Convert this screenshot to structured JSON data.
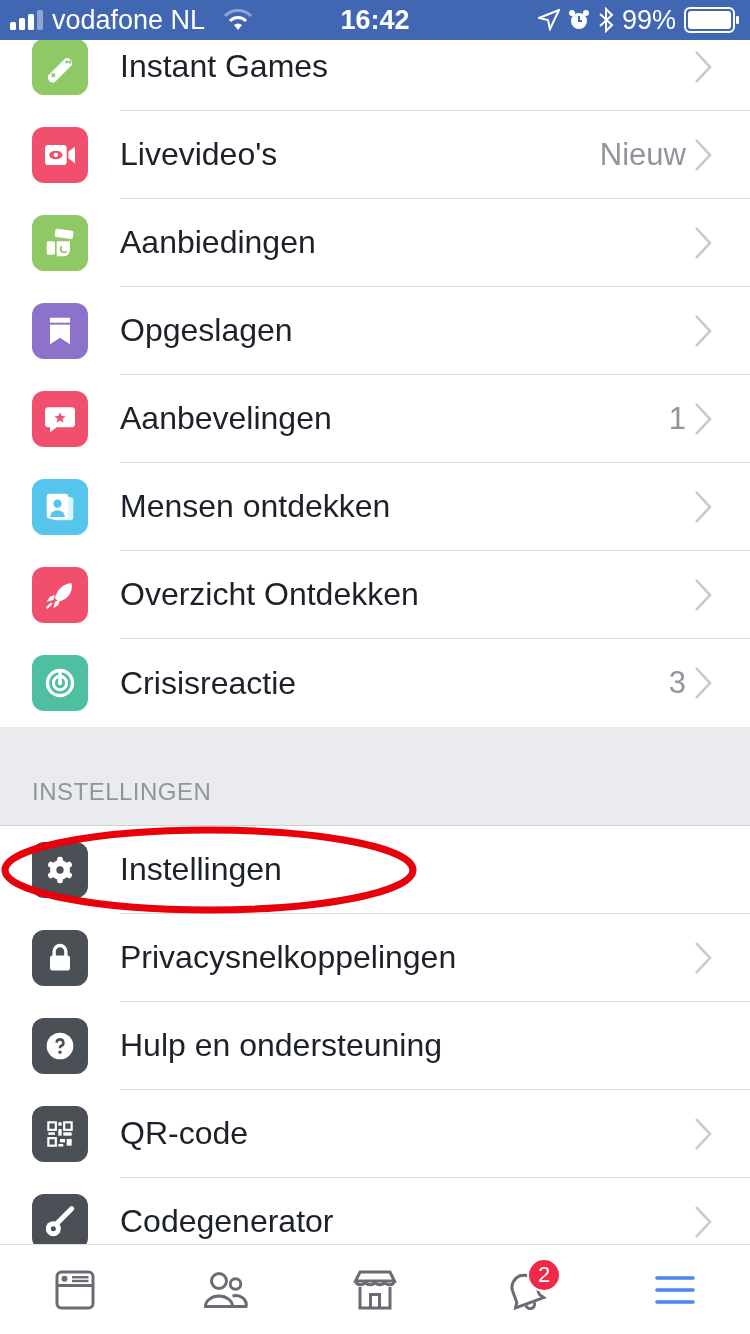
{
  "status_bar": {
    "carrier": "vodafone NL",
    "time": "16:42",
    "battery": "99%"
  },
  "sections": [
    {
      "items": [
        {
          "label": "Instant Games",
          "color": "#8fc966",
          "chevron": true,
          "circled": false
        },
        {
          "label": "Livevideo's",
          "detail": "Nieuw",
          "color": "#f0506e",
          "chevron": true,
          "circled": false
        },
        {
          "label": "Aanbiedingen",
          "color": "#8fc966",
          "chevron": true,
          "circled": false
        },
        {
          "label": "Opgeslagen",
          "color": "#8c72cb",
          "chevron": true,
          "circled": false
        },
        {
          "label": "Aanbevelingen",
          "detail": "1",
          "color": "#f0506e",
          "chevron": true,
          "circled": false
        },
        {
          "label": "Mensen ontdekken",
          "color": "#56c5ec",
          "chevron": true,
          "circled": false
        },
        {
          "label": "Overzicht Ontdekken",
          "color": "#f0506e",
          "chevron": true,
          "circled": false
        },
        {
          "label": "Crisisreactie",
          "detail": "3",
          "color": "#4fbfa2",
          "chevron": true,
          "circled": false
        }
      ]
    },
    {
      "header": "INSTELLINGEN",
      "items": [
        {
          "label": "Instellingen",
          "color": "#4b4f56",
          "chevron": false,
          "circled": true
        },
        {
          "label": "Privacysnelkoppelingen",
          "color": "#4b4f56",
          "chevron": true,
          "circled": false
        },
        {
          "label": "Hulp en ondersteuning",
          "color": "#4b4f56",
          "chevron": false,
          "circled": false
        },
        {
          "label": "QR-code",
          "color": "#4b4f56",
          "chevron": true,
          "circled": false
        },
        {
          "label": "Codegenerator",
          "color": "#4b4f56",
          "chevron": true,
          "circled": false
        }
      ]
    }
  ],
  "tab_bar": [
    {
      "selected": false
    },
    {
      "selected": false
    },
    {
      "selected": false
    },
    {
      "selected": false,
      "badge": "2"
    },
    {
      "selected": true
    }
  ]
}
